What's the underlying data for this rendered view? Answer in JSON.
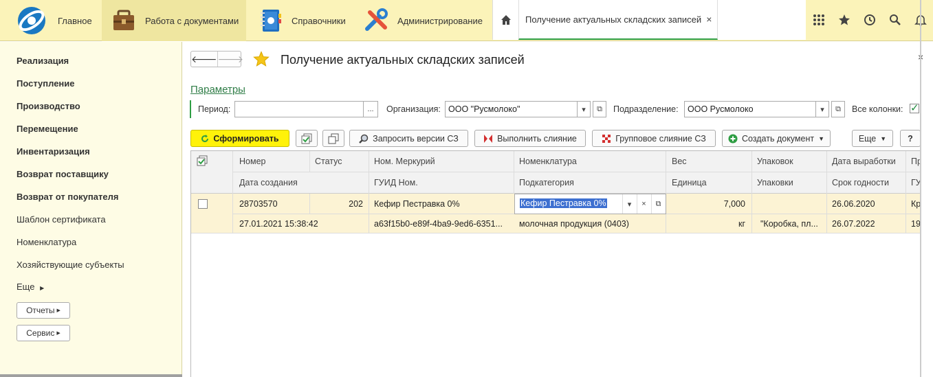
{
  "topbar": {
    "sections": [
      {
        "label": "Главное",
        "icon": "logo-icon"
      },
      {
        "label": "Работа с документами",
        "icon": "briefcase-icon"
      },
      {
        "label": "Справочники",
        "icon": "notebook-icon"
      },
      {
        "label": "Администрирование",
        "icon": "tools-icon"
      }
    ],
    "home_icon": "home-icon",
    "active_tab": "Получение актуальных складских записей",
    "tab_close": "×",
    "right_icons": [
      "apps-grid-icon",
      "star-icon",
      "history-icon",
      "search-icon",
      "bell-icon"
    ]
  },
  "sidebar": {
    "items": [
      {
        "label": "Реализация",
        "bold": true
      },
      {
        "label": "Поступление",
        "bold": true
      },
      {
        "label": "Производство",
        "bold": true
      },
      {
        "label": "Перемещение",
        "bold": true
      },
      {
        "label": "Инвентаризация",
        "bold": true
      },
      {
        "label": "Возврат поставщику",
        "bold": true
      },
      {
        "label": "Возврат от покупателя",
        "bold": true
      },
      {
        "label": "Шаблон сертификата",
        "bold": false
      },
      {
        "label": "Номенклатура",
        "bold": false
      },
      {
        "label": "Хозяйствующие субъекты",
        "bold": false
      }
    ],
    "more": "Еще",
    "reports": "Отчеты",
    "service": "Сервис"
  },
  "form": {
    "title": "Получение актуальных складских записей",
    "close": "×",
    "params_link": "Параметры",
    "period_label": "Период:",
    "period_value": "",
    "period_btn": "...",
    "org_label": "Организация:",
    "org_value": "ООО \"Русмолоко\"",
    "dept_label": "Подразделение:",
    "dept_value": "ООО Русмолоко",
    "all_columns_label": "Все колонки:",
    "all_columns_checked": true
  },
  "toolbar": {
    "generate": "Сформировать",
    "request_versions": "Запросить версии СЗ",
    "merge": "Выполнить слияние",
    "group_merge": "Групповое слияние СЗ",
    "create_doc": "Создать документ",
    "more": "Еще",
    "help": "?"
  },
  "table": {
    "headers_top": [
      "Номер",
      "Статус",
      "Ном. Меркурий",
      "Номенклатура",
      "Вес",
      "Упаковок",
      "Дата выработки",
      "Пр"
    ],
    "headers_bottom": [
      "Дата создания",
      "ГУИД Ном.",
      "Подкатегория",
      "Единица",
      "Упаковки",
      "Срок годности",
      "ГУ"
    ],
    "row": {
      "number": "28703570",
      "status": "202",
      "merc_nom": "Кефир Пестравка 0%",
      "nomenclature": "Кефир Пестравка 0%",
      "weight": "7,000",
      "packages": "",
      "produced": "26.06.2020",
      "extra_top": "Кр",
      "created": "27.01.2021 15:38:42",
      "guid": "a63f15b0-e89f-4ba9-9ed6-6351...",
      "subcategory": "молочная продукция (0403)",
      "unit": "кг",
      "packaging": "\"Коробка, пл...",
      "expiry": "26.07.2022",
      "extra_bottom": "19"
    }
  },
  "colors": {
    "topbar_bg": "#fbf3b9",
    "sidebar_bg": "#fefce5",
    "primary_btn": "#fff20a",
    "accent_green": "#2f9e44",
    "row_bg": "#fcf3d4",
    "selection": "#3d6fd0"
  }
}
